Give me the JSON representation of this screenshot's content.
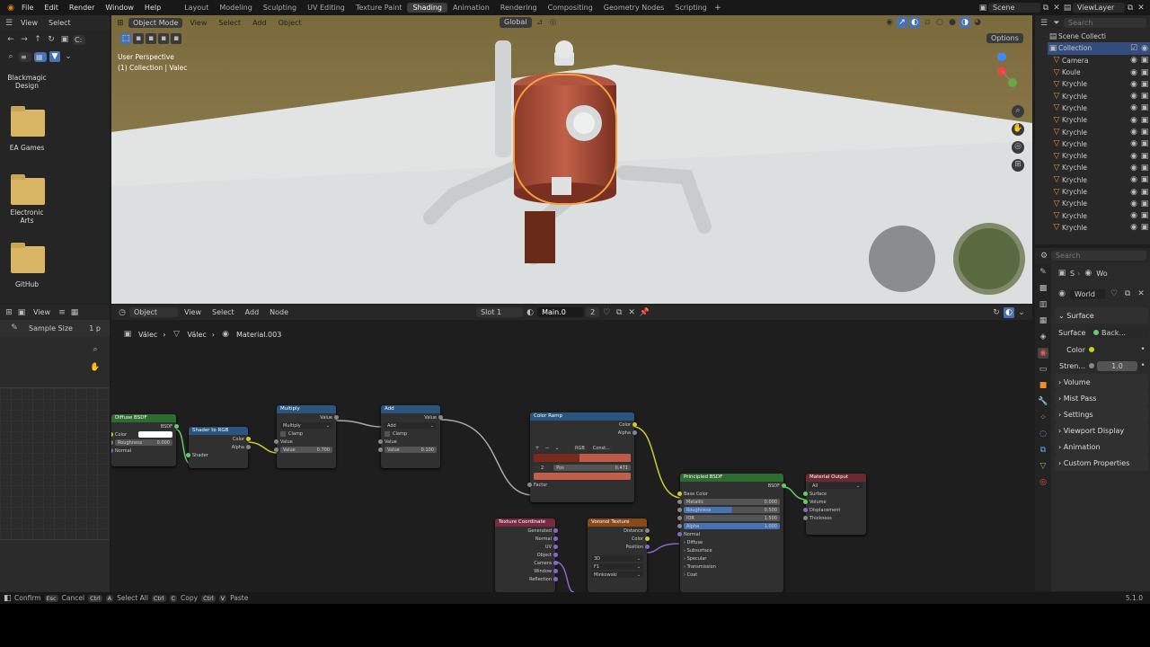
{
  "menu": [
    "File",
    "Edit",
    "Render",
    "Window",
    "Help"
  ],
  "workspaces": [
    "Layout",
    "Modeling",
    "Sculpting",
    "UV Editing",
    "Texture Paint",
    "Shading",
    "Animation",
    "Rendering",
    "Compositing",
    "Geometry Nodes",
    "Scripting"
  ],
  "active_workspace": "Shading",
  "scene": "Scene",
  "view_layer": "ViewLayer",
  "search_placeholder": "Search",
  "file_browser": {
    "menu": [
      "View",
      "Select"
    ],
    "path": "C:",
    "folders": [
      "Blackmagic Design",
      "EA Games",
      "Electronic Arts",
      "GitHub"
    ]
  },
  "viewport": {
    "mode": "Object Mode",
    "menu": [
      "View",
      "Select",
      "Add",
      "Object"
    ],
    "orientation": "Global",
    "options": "Options",
    "info_line1": "User Perspective",
    "info_line2": "(1) Collection | Valec"
  },
  "outliner": {
    "scene_collection": "Scene Collecti",
    "collection": "Collection",
    "items": [
      "Camera",
      "Koule",
      "Krychle",
      "Krychle",
      "Krychle",
      "Krychle",
      "Krychle",
      "Krychle",
      "Krychle",
      "Krychle",
      "Krychle",
      "Krychle",
      "Krychle",
      "Krychle",
      "Krychle"
    ]
  },
  "properties": {
    "search": "Search",
    "tab1": "S",
    "tab2": "Wo",
    "world": "World",
    "surface_panel": "Surface",
    "surface_label": "Surface",
    "surface_value": "Back...",
    "color_label": "Color",
    "strength_label": "Stren...",
    "strength_value": "1.0",
    "panels": [
      "Volume",
      "Mist Pass",
      "Settings",
      "Viewport Display",
      "Animation",
      "Custom Properties"
    ]
  },
  "image_editor": {
    "menu": "View",
    "tool_label": "Sample Size",
    "tool_value": "1 p"
  },
  "node_editor": {
    "type": "Object",
    "menu": [
      "View",
      "Select",
      "Add",
      "Node"
    ],
    "slot": "Slot 1",
    "material": "Main.0",
    "users": "2",
    "breadcrumb": [
      "Válec",
      "Válec",
      "Material.003"
    ]
  },
  "nodes": {
    "diffuse": {
      "title": "Diffuse BSDF",
      "out": "BSDF",
      "color": "Color",
      "roughness": "Roughness",
      "roughness_val": "0.000",
      "normal": "Normal"
    },
    "shader_rgb": {
      "title": "Shader to RGB",
      "color": "Color",
      "alpha": "Alpha",
      "shader": "Shader"
    },
    "multiply": {
      "title": "Multiply",
      "out": "Value",
      "op": "Multiply",
      "clamp": "Clamp",
      "value": "Value",
      "value_label": "Value",
      "value_val": "0.700"
    },
    "add": {
      "title": "Add",
      "out": "Value",
      "op": "Add",
      "clamp": "Clamp",
      "value": "Value",
      "value_label": "Value",
      "value_val": "0.100"
    },
    "ramp": {
      "title": "Color Ramp",
      "color": "Color",
      "alpha": "Alpha",
      "mode": "RGB",
      "interp": "Const...",
      "idx": "2",
      "pos": "Pos",
      "pos_val": "0.471",
      "factor": "Factor"
    },
    "principled": {
      "title": "Principled BSDF",
      "out": "BSDF",
      "base": "Base Color",
      "metallic": "Metallic",
      "metallic_val": "0.000",
      "roughness": "Roughness",
      "roughness_val": "0.500",
      "ior": "IOR",
      "ior_val": "1.500",
      "alpha": "Alpha",
      "alpha_val": "1.000",
      "normal": "Normal",
      "sections": [
        "Diffuse",
        "Subsurface",
        "Specular",
        "Transmission",
        "Coat"
      ]
    },
    "output": {
      "title": "Material Output",
      "target": "All",
      "surface": "Surface",
      "volume": "Volume",
      "displacement": "Displacement",
      "thickness": "Thickness"
    },
    "texcoord": {
      "title": "Texture Coordinate",
      "outputs": [
        "Generated",
        "Normal",
        "UV",
        "Object",
        "Camera",
        "Window",
        "Reflection"
      ]
    },
    "voronoi": {
      "title": "Voronoi Texture",
      "distance": "Distance",
      "color": "Color",
      "position": "Position",
      "dim": "3D",
      "feature": "F1",
      "metric": "Minkowski"
    }
  },
  "status": {
    "confirm": "Confirm",
    "cancel": "Cancel",
    "select_all": "Select All",
    "copy": "Copy",
    "paste": "Paste",
    "version": "5.1.0",
    "key_esc": "Esc",
    "key_ctrl": "Ctrl",
    "key_a": "A",
    "key_c": "C",
    "key_v": "V"
  }
}
